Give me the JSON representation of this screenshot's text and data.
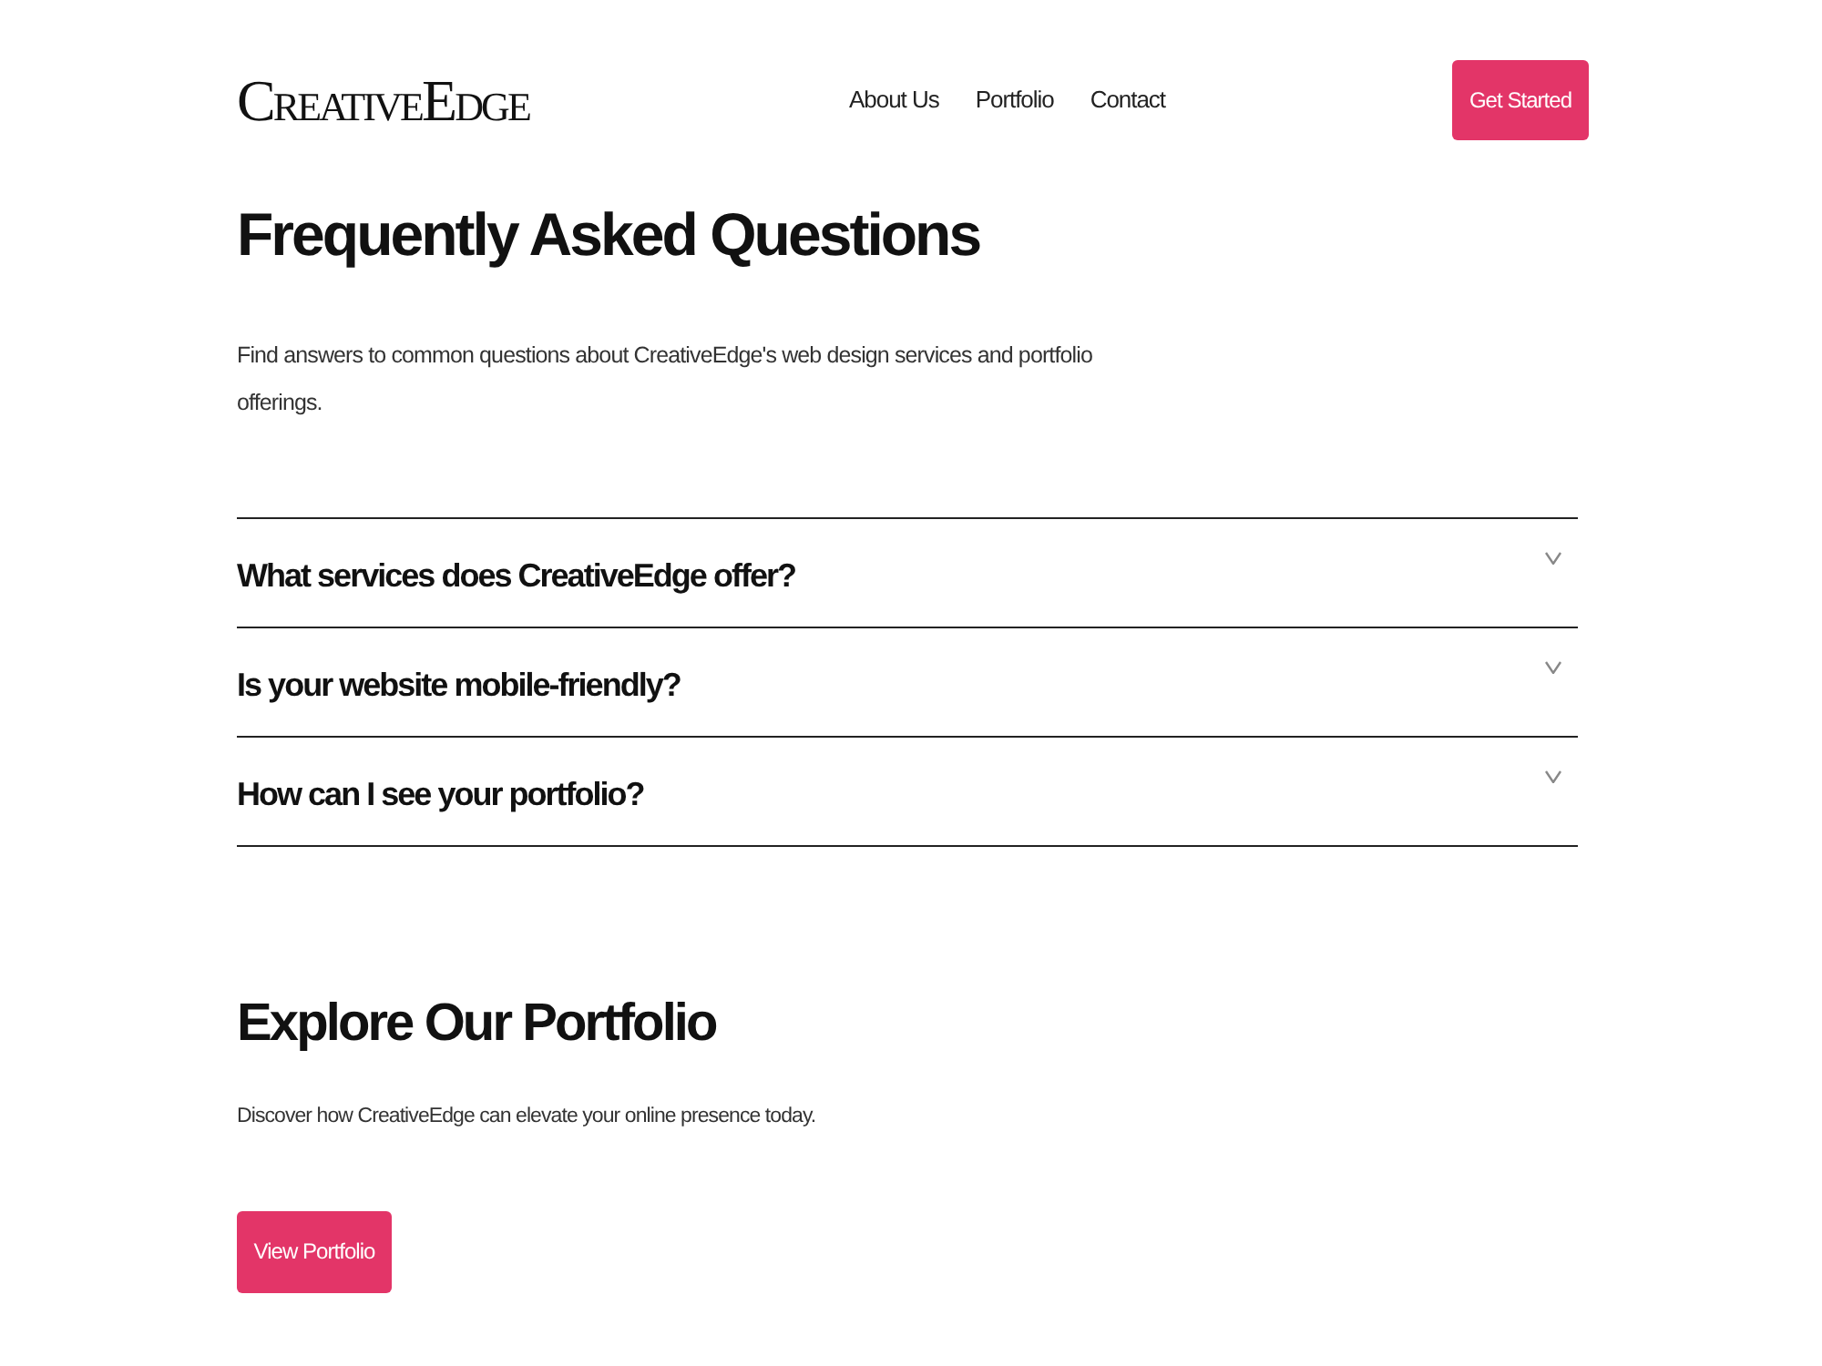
{
  "header": {
    "logo": "CreativeEdge",
    "nav": [
      {
        "label": "About Us"
      },
      {
        "label": "Portfolio"
      },
      {
        "label": "Contact"
      }
    ],
    "cta": "Get Started"
  },
  "faq": {
    "title": "Frequently Asked Questions",
    "intro": "Find answers to common questions about CreativeEdge's web design services and portfolio offerings.",
    "items": [
      {
        "question": "What services does CreativeEdge offer?",
        "expanded": false
      },
      {
        "question": "Is your website mobile-friendly?",
        "expanded": false
      },
      {
        "question": "How can I see your portfolio?",
        "expanded": false
      }
    ]
  },
  "portfolio": {
    "title": "Explore Our Portfolio",
    "text": "Discover how CreativeEdge can elevate your online presence today.",
    "button": "View Portfolio"
  }
}
